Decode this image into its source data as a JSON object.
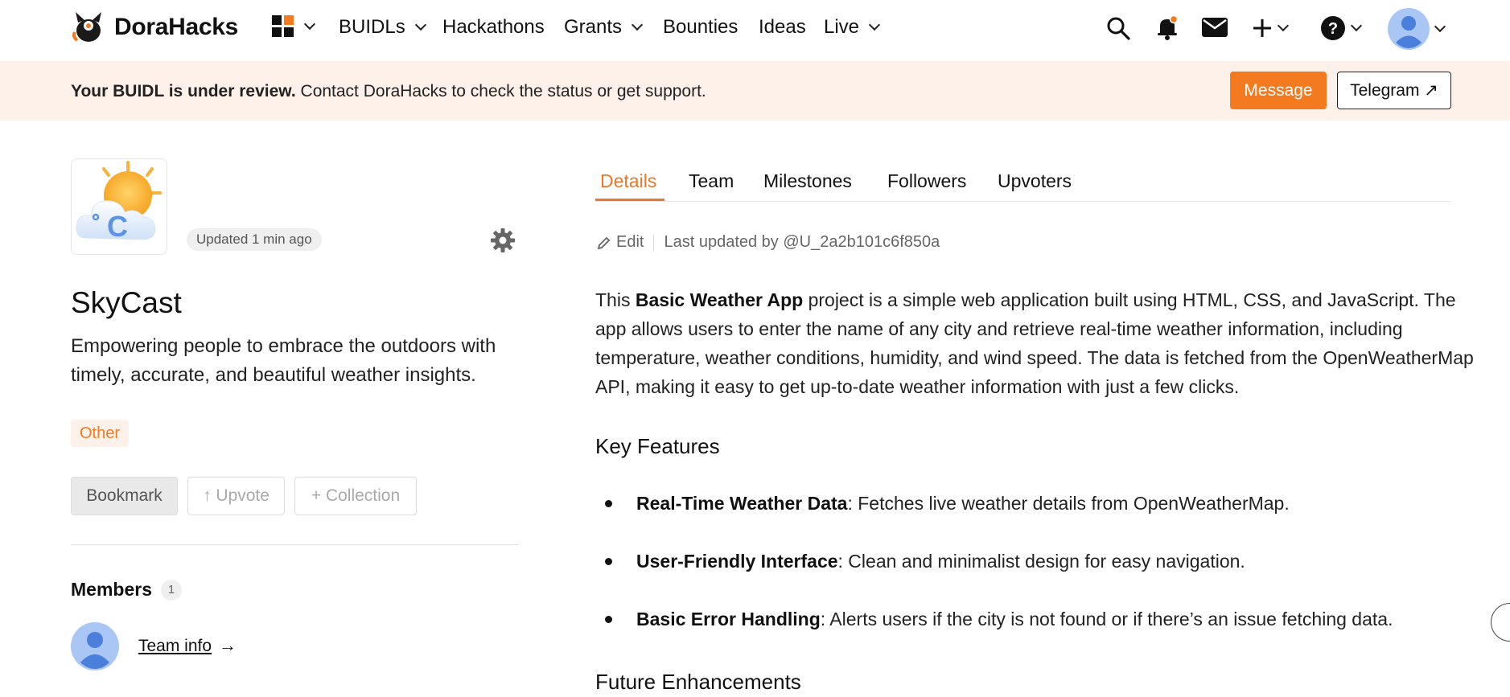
{
  "nav": {
    "brand": "DoraHacks",
    "items": [
      {
        "label": "BUIDLs",
        "dropdown": true
      },
      {
        "label": "Hackathons",
        "dropdown": false
      },
      {
        "label": "Grants",
        "dropdown": true
      },
      {
        "label": "Bounties",
        "dropdown": false
      },
      {
        "label": "Ideas",
        "dropdown": false
      },
      {
        "label": "Live",
        "dropdown": true
      }
    ],
    "icons": [
      "apps-grid-icon",
      "search-icon",
      "bell-icon",
      "mail-icon",
      "plus-icon",
      "help-icon",
      "avatar"
    ]
  },
  "banner": {
    "bold": "Your BUIDL is under review.",
    "text": " Contact DoraHacks to check the status or get support.",
    "message_label": "Message",
    "telegram_label": "Telegram ↗"
  },
  "project": {
    "updated": "Updated 1 min ago",
    "title": "SkyCast",
    "tagline": "Empowering people to embrace the outdoors with timely, accurate, and beautiful weather insights.",
    "tag": "Other",
    "bookmark_label": "Bookmark",
    "upvote_label": "↑ Upvote",
    "collection_label": "+ Collection"
  },
  "members": {
    "title": "Members",
    "count": "1",
    "team_link": "Team info",
    "arrow": "→"
  },
  "tabs": [
    "Details",
    "Team",
    "Milestones",
    "Followers",
    "Upvoters"
  ],
  "details": {
    "edit_label": "Edit",
    "last_updated": "Last updated by @U_2a2b101c6f850a",
    "desc_pre": "This ",
    "desc_bold": "Basic Weather App",
    "desc_post": " project is a simple web application built using HTML, CSS, and JavaScript. The app allows users to enter the name of any city and retrieve real-time weather information, including temperature, weather conditions, humidity, and wind speed. The data is fetched from the OpenWeatherMap API, making it easy to get up-to-date weather information with just a few clicks.",
    "key_features_title": "Key Features",
    "features": [
      {
        "bold": "Real-Time Weather Data",
        "text": ": Fetches live weather details from OpenWeatherMap."
      },
      {
        "bold": "User-Friendly Interface",
        "text": ": Clean and minimalist design for easy navigation."
      },
      {
        "bold": "Basic Error Handling",
        "text": ": Alerts users if the city is not found or if there’s an issue fetching data."
      }
    ],
    "future_title": "Future Enhancements"
  },
  "colors": {
    "accent": "#f47a20",
    "banner_bg": "#fdf1ea",
    "avatar_blue": "#6f9ef0"
  }
}
